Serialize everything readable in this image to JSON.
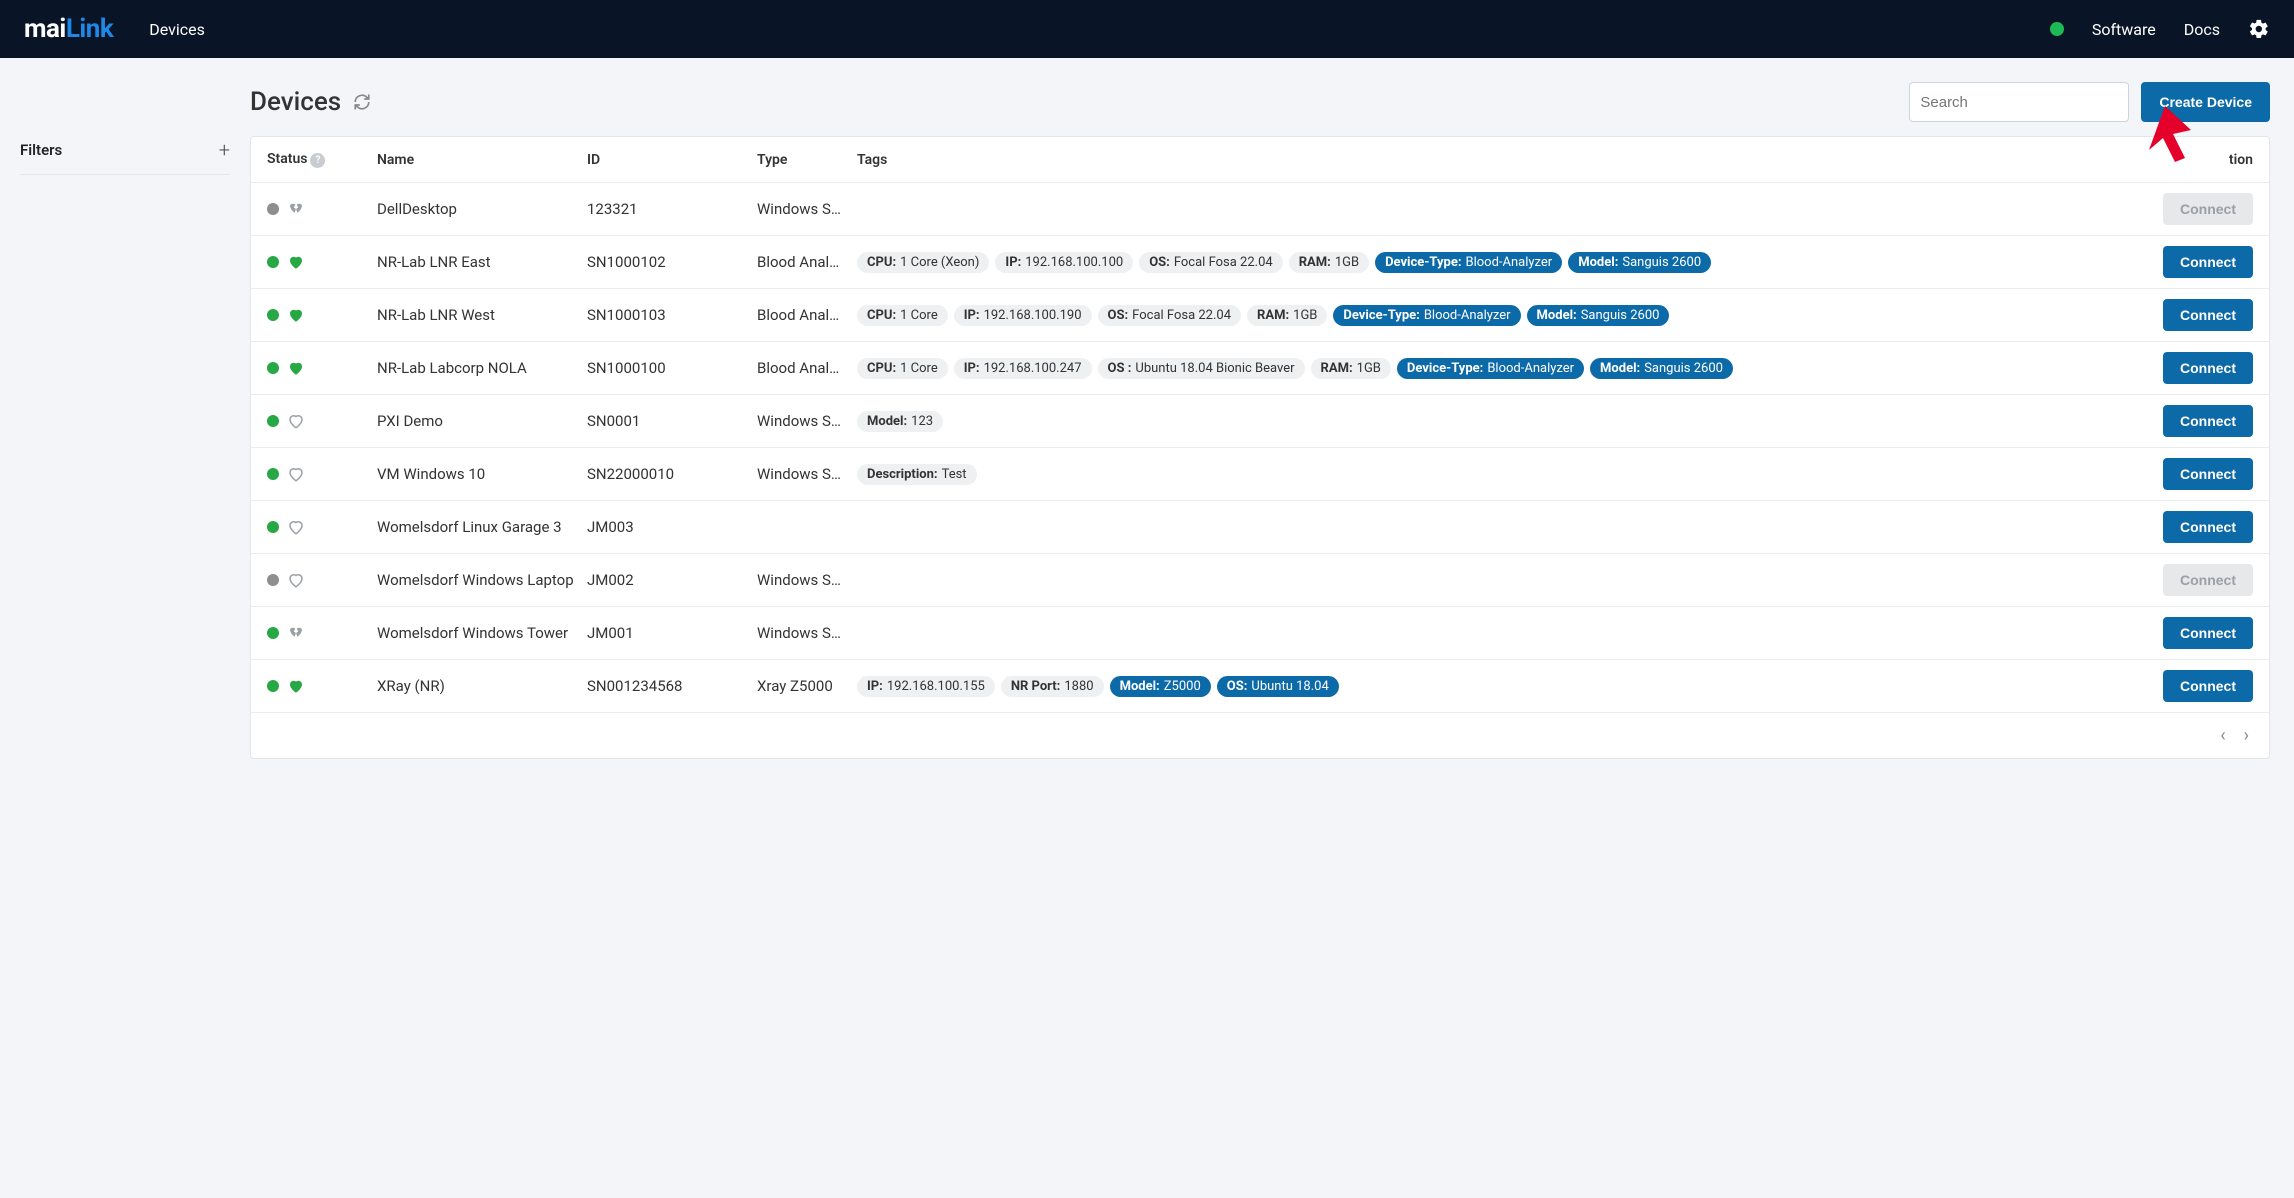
{
  "header": {
    "logo_mai": "mai",
    "logo_link": "Link",
    "nav_devices": "Devices",
    "link_software": "Software",
    "link_docs": "Docs"
  },
  "sidebar": {
    "filters_label": "Filters"
  },
  "page": {
    "title": "Devices",
    "search_placeholder": "Search",
    "create_button": "Create Device"
  },
  "columns": {
    "status": "Status",
    "name": "Name",
    "id": "ID",
    "type": "Type",
    "tags": "Tags",
    "action": "tion"
  },
  "connect_label": "Connect",
  "devices": [
    {
      "status_color": "gray",
      "heart": "broken-gray",
      "name": "DellDesktop",
      "id": "123321",
      "type": "Windows S…",
      "tags": [],
      "connect_enabled": false
    },
    {
      "status_color": "green",
      "heart": "full-green",
      "name": "NR-Lab LNR East",
      "id": "SN1000102",
      "type": "Blood Anal…",
      "tags": [
        {
          "style": "gray",
          "key": "CPU:",
          "val": "1 Core (Xeon)"
        },
        {
          "style": "gray",
          "key": "IP:",
          "val": "192.168.100.100"
        },
        {
          "style": "gray",
          "key": "OS:",
          "val": "Focal Fosa 22.04"
        },
        {
          "style": "gray",
          "key": "RAM:",
          "val": "1GB"
        },
        {
          "style": "blue",
          "key": "Device-Type:",
          "val": "Blood-Analyzer"
        },
        {
          "style": "blue",
          "key": "Model:",
          "val": "Sanguis 2600"
        }
      ],
      "connect_enabled": true
    },
    {
      "status_color": "green",
      "heart": "full-green",
      "name": "NR-Lab LNR West",
      "id": "SN1000103",
      "type": "Blood Anal…",
      "tags": [
        {
          "style": "gray",
          "key": "CPU:",
          "val": "1 Core"
        },
        {
          "style": "gray",
          "key": "IP:",
          "val": "192.168.100.190"
        },
        {
          "style": "gray",
          "key": "OS:",
          "val": "Focal Fosa 22.04"
        },
        {
          "style": "gray",
          "key": "RAM:",
          "val": "1GB"
        },
        {
          "style": "blue",
          "key": "Device-Type:",
          "val": "Blood-Analyzer"
        },
        {
          "style": "blue",
          "key": "Model:",
          "val": "Sanguis 2600"
        }
      ],
      "connect_enabled": true
    },
    {
      "status_color": "green",
      "heart": "full-green",
      "name": "NR-Lab Labcorp NOLA",
      "id": "SN1000100",
      "type": "Blood Anal…",
      "tags": [
        {
          "style": "gray",
          "key": "CPU:",
          "val": "1 Core"
        },
        {
          "style": "gray",
          "key": "IP:",
          "val": "192.168.100.247"
        },
        {
          "style": "gray",
          "key": "OS :",
          "val": "Ubuntu 18.04 Bionic Beaver"
        },
        {
          "style": "gray",
          "key": "RAM:",
          "val": "1GB"
        },
        {
          "style": "blue",
          "key": "Device-Type:",
          "val": "Blood-Analyzer"
        },
        {
          "style": "blue",
          "key": "Model:",
          "val": "Sanguis 2600"
        }
      ],
      "connect_enabled": true
    },
    {
      "status_color": "green",
      "heart": "outline-gray",
      "name": "PXI Demo",
      "id": "SN0001",
      "type": "Windows S…",
      "tags": [
        {
          "style": "gray",
          "key": "Model:",
          "val": "123"
        }
      ],
      "connect_enabled": true
    },
    {
      "status_color": "green",
      "heart": "outline-gray",
      "name": "VM Windows 10",
      "id": "SN22000010",
      "type": "Windows S…",
      "tags": [
        {
          "style": "gray",
          "key": "Description:",
          "val": "Test"
        }
      ],
      "connect_enabled": true
    },
    {
      "status_color": "green",
      "heart": "outline-gray",
      "name": "Womelsdorf Linux Garage 3",
      "id": "JM003",
      "type": "",
      "tags": [],
      "connect_enabled": true
    },
    {
      "status_color": "gray",
      "heart": "outline-gray",
      "name": "Womelsdorf Windows Laptop",
      "id": "JM002",
      "type": "Windows S…",
      "tags": [],
      "connect_enabled": false
    },
    {
      "status_color": "green",
      "heart": "broken-gray",
      "name": "Womelsdorf Windows Tower",
      "id": "JM001",
      "type": "Windows S…",
      "tags": [],
      "connect_enabled": true
    },
    {
      "status_color": "green",
      "heart": "full-green",
      "name": "XRay (NR)",
      "id": "SN001234568",
      "type": "Xray Z5000",
      "tags": [
        {
          "style": "gray",
          "key": "IP:",
          "val": "192.168.100.155"
        },
        {
          "style": "gray",
          "key": "NR Port:",
          "val": "1880"
        },
        {
          "style": "blue",
          "key": "Model:",
          "val": "Z5000"
        },
        {
          "style": "blue",
          "key": "OS:",
          "val": "Ubuntu 18.04"
        }
      ],
      "connect_enabled": true
    }
  ]
}
